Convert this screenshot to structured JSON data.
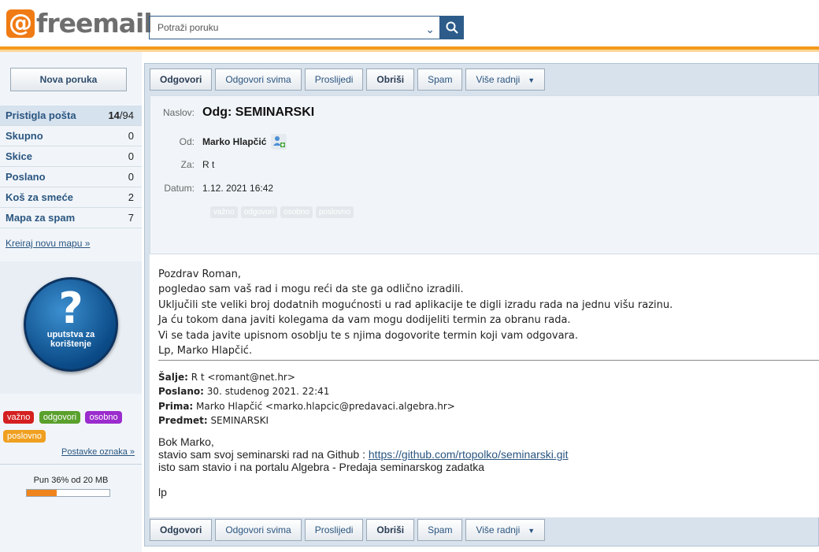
{
  "logo": {
    "at": "@",
    "text": "freemail"
  },
  "search": {
    "placeholder": "Potraži poruku"
  },
  "sidebar": {
    "new_message": "Nova poruka",
    "folders": [
      {
        "name": "Pristigla pošta",
        "unread": "14",
        "total": "/94",
        "active": true
      },
      {
        "name": "Skupno",
        "count": "0"
      },
      {
        "name": "Skice",
        "count": "0"
      },
      {
        "name": "Poslano",
        "count": "0"
      },
      {
        "name": "Koš za smeće",
        "count": "2"
      },
      {
        "name": "Mapa za spam",
        "count": "7"
      }
    ],
    "create_folder": "Kreiraj novu mapu »",
    "help": {
      "line1": "uputstva za",
      "line2": "korištenje"
    },
    "tags": [
      {
        "label": "važno",
        "color": "#d42020"
      },
      {
        "label": "odgovori",
        "color": "#5aa02c"
      },
      {
        "label": "osobno",
        "color": "#9b2ccd"
      },
      {
        "label": "poslovno",
        "color": "#f0a020"
      }
    ],
    "tag_settings": "Postavke oznaka »",
    "quota": {
      "text": "Pun 36% od 20 MB",
      "percent": 36
    }
  },
  "toolbar": {
    "reply": "Odgovori",
    "reply_all": "Odgovori svima",
    "forward": "Proslijedi",
    "delete": "Obriši",
    "spam": "Spam",
    "more": "Više radnji"
  },
  "message": {
    "labels": {
      "subject": "Naslov:",
      "from": "Od:",
      "to": "Za:",
      "date": "Datum:"
    },
    "subject": "Odg: SEMINARSKI",
    "from": "Marko Hlapčić",
    "to": "R t",
    "date": "1.12. 2021 16:42",
    "flag_tags": [
      "važno",
      "odgovori",
      "osobno",
      "poslovno"
    ],
    "body_lines": [
      "Pozdrav Roman,",
      "pogledao sam vaš rad i mogu reći da ste ga odlično izradili.",
      "Uključili ste veliki broj dodatnih mogućnosti u rad aplikacije te digli izradu rada na jednu višu razinu.",
      "Ja ću tokom dana javiti kolegama da vam mogu dodijeliti termin za obranu rada.",
      "Vi se tada javite upisnom osoblju te s njima dogovorite termin koji vam odgovara.",
      "Lp, Marko Hlapčić."
    ],
    "quoted": {
      "sender_label": "Šalje:",
      "sender": " R t <romant@net.hr>",
      "sent_label": "Poslano:",
      "sent": " 30. studenog 2021. 22:41",
      "to_label": "Prima:",
      "to": " Marko Hlapčić <marko.hlapcic@predavaci.algebra.hr>",
      "subject_label": "Predmet:",
      "subject": " SEMINARSKI",
      "greeting": "Bok Marko,",
      "line1_prefix": "stavio sam svoj seminarski rad na Github : ",
      "link": "https://github.com/rtopolko/seminarski.git",
      "line2": "isto sam stavio i na portalu Algebra - Predaja seminarskog zadatka",
      "sign": "lp"
    }
  }
}
